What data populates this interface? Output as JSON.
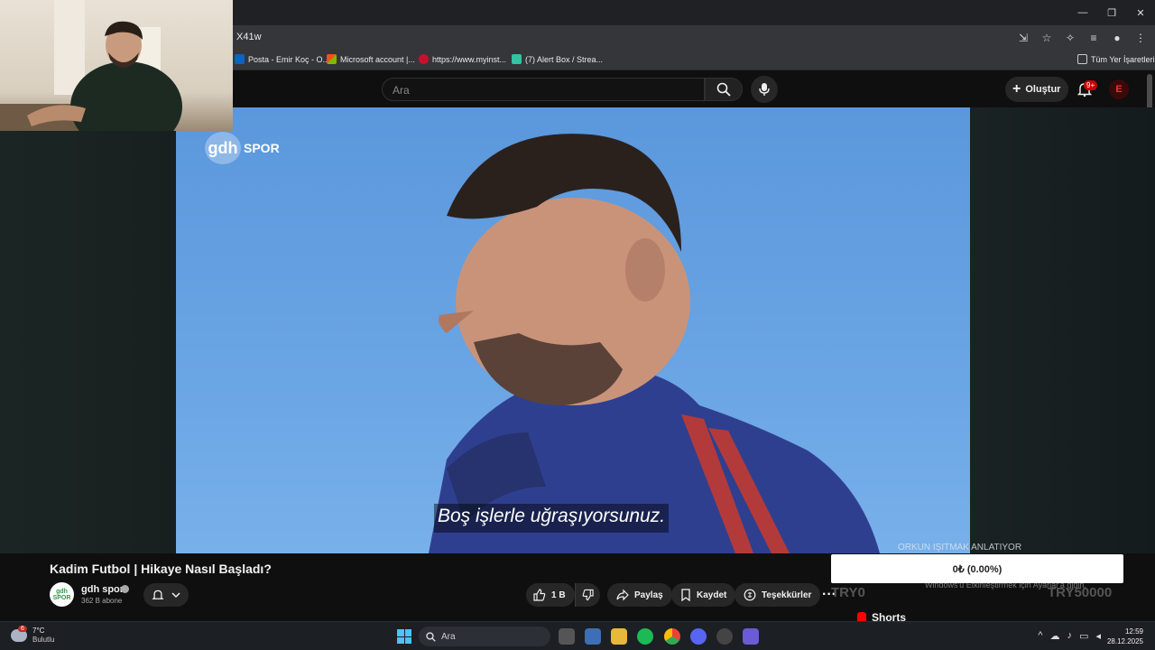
{
  "browser": {
    "url_fragment": "X41w",
    "window_controls": {
      "minimize": "—",
      "restore": "❐",
      "close": "✕"
    },
    "bookmarks": [
      {
        "label": "Posta - Emir Koç - O...",
        "color": "#0a64c2"
      },
      {
        "label": "Microsoft account |...",
        "color": "#f25022"
      },
      {
        "label": "https://www.myinst...",
        "color": "#c8102e"
      },
      {
        "label": "(7) Alert Box / Strea...",
        "color": "#31c3a2"
      }
    ],
    "all_bookmarks": "Tüm Yer İşaretleri"
  },
  "youtube": {
    "search_placeholder": "Ara",
    "create_label": "Oluştur",
    "notification_count": "9+",
    "avatar_letter": "E",
    "brand_red": "#ff0000"
  },
  "video": {
    "watermark_logo": "gdh",
    "watermark_text": "SPOR",
    "subtitle": "Boş işlerle uğraşıyorsunuz.",
    "credit": "ORKUN IŞITMAK ANLATIYOR",
    "title": "Kadim Futbol | Hikaye Nasıl Başladı?",
    "channel_name": "gdh spor",
    "channel_avatar_text": "gdh SPOR",
    "subscribers": "362 B abone",
    "likes": "1 B",
    "share_label": "Paylaş",
    "save_label": "Kaydet",
    "thanks_label": "Teşekkürler",
    "more_label": "···"
  },
  "overlay": {
    "donation_value": "0₺ (0.00%)",
    "ghost_left": "TRY0",
    "ghost_right": "TRY50000",
    "ghost_note": "Windows'u Etkinleştirmek için Ayarlar'a gidin.",
    "shorts_label": "Shorts"
  },
  "taskbar": {
    "temperature": "7°C",
    "weather_desc": "Bulutlu",
    "weather_badge": "6",
    "search_placeholder": "Ara",
    "time": "12:59",
    "date": "28.12.2025"
  }
}
